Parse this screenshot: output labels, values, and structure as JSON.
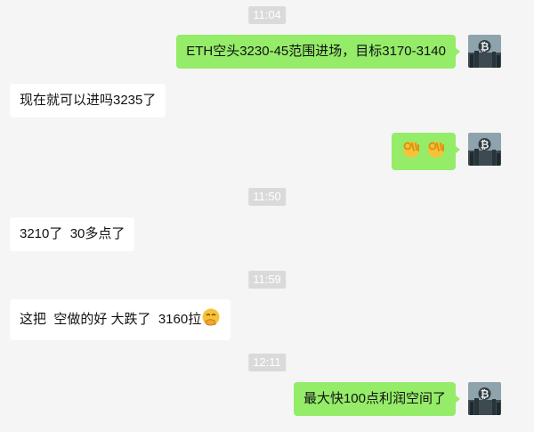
{
  "messages": [
    {
      "type": "time",
      "text": "11:04"
    },
    {
      "type": "out",
      "text": "ETH空头3230-45范围进场，目标3170-3140"
    },
    {
      "type": "in",
      "text": "现在就可以进吗3235了"
    },
    {
      "type": "out",
      "text": "",
      "emoji": [
        "ok-hand-emoji",
        "ok-hand-emoji"
      ]
    },
    {
      "type": "time",
      "text": "11:50"
    },
    {
      "type": "in",
      "text": "3210了  30多点了"
    },
    {
      "type": "time",
      "text": "11:59"
    },
    {
      "type": "in",
      "text": "这把  空做的好 大跌了  3160拉",
      "emoji": [
        "hand-over-mouth-emoji"
      ]
    },
    {
      "type": "time",
      "text": "12:11"
    },
    {
      "type": "out",
      "text": "最大快100点利润空间了"
    }
  ],
  "colors": {
    "background": "#f5f5f5",
    "out_bubble": "#95ec69",
    "in_bubble": "#ffffff",
    "time_badge": "#dadada"
  },
  "avatar": {
    "icon": "bitcoin-city-avatar"
  }
}
